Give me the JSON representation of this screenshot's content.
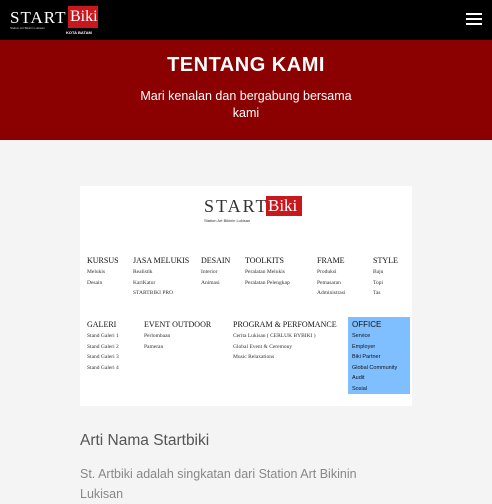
{
  "navbar": {
    "logo_start": "START",
    "logo_biki": "Biki",
    "logo_tagline": "Station Art Bikinin Lukisan",
    "logo_kota": "KOTA BATAM"
  },
  "hero": {
    "title": "TENTANG KAMI",
    "subtitle": "Mari kenalan dan bergabung bersama kami"
  },
  "diagram": {
    "logo_start": "START",
    "logo_biki": "Biki",
    "logo_tagline": "Station Art Bikinin Lukisan",
    "row1": [
      {
        "heading": "KURSUS",
        "items": [
          "Melukis",
          "Desain"
        ]
      },
      {
        "heading": "JASA MELUKIS",
        "items": [
          "Realistik",
          "KariKatur",
          "STARTBIKI PRO"
        ]
      },
      {
        "heading": "DESAIN",
        "items": [
          "Interior",
          "Animasi"
        ]
      },
      {
        "heading": "TOOLKITS",
        "items": [
          "Peralatan Melukis",
          "Peralatan Pelengkap"
        ]
      },
      {
        "heading": "FRAME",
        "items": [
          "Produksi",
          "Pemasaran",
          "Administrasi"
        ]
      },
      {
        "heading": "STYLE",
        "items": [
          "Baju",
          "Topi",
          "Tas"
        ]
      }
    ],
    "row2": [
      {
        "heading": "GALERI",
        "items": [
          "Stand Galeri 1",
          "Stand Galeri 2",
          "Stand Galeri 3",
          "Stand Galeri 4"
        ]
      },
      {
        "heading": "EVENT OUTDOOR",
        "items": [
          "Perlombaan",
          "Pameran"
        ]
      },
      {
        "heading": "PROGRAM & PERFOMANCE",
        "items": [
          "Cerita Lukisan ( CERLUK BYBIKI )",
          "Global Event & Ceremony",
          "Music Relaxations"
        ]
      }
    ],
    "office": {
      "heading": "OFFICE",
      "items": [
        "Service",
        "Employer",
        "Biki Partner",
        "Global Community",
        "Audit",
        "Sosial"
      ]
    },
    "colors": {
      "brand_red": "#c8181e",
      "office_highlight": "#7fbfff"
    }
  },
  "section": {
    "title": "Arti Nama Startbiki",
    "text": "St. Artbiki adalah singkatan dari Station Art Bikinin Lukisan"
  },
  "colors": {
    "navbar": "#000000",
    "hero": "#8b0000",
    "page_bg": "#f4f4f4"
  },
  "icons": {
    "menu": "hamburger-menu-icon"
  }
}
